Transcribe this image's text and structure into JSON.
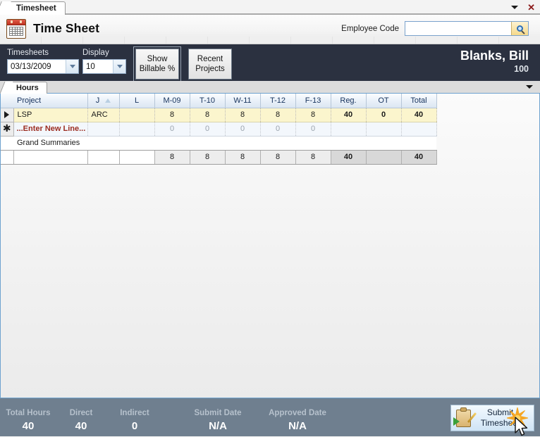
{
  "window": {
    "tab_label": "Timesheet",
    "minimize_icon": "chevron-down-icon",
    "close_icon": "close-icon",
    "close_label": "✕"
  },
  "header": {
    "app_icon": "calendar-icon",
    "title": "Time Sheet",
    "employee_code_label": "Employee Code",
    "employee_code_value": "",
    "employee_code_placeholder": "",
    "search_icon": "magnifier-search-icon"
  },
  "toolbar": {
    "timesheets_label": "Timesheets",
    "timesheets_value": "03/13/2009",
    "display_label": "Display",
    "display_value": "10",
    "show_billable_label_line1": "Show",
    "show_billable_label_line2": "Billable %",
    "recent_projects_label_line1": "Recent",
    "recent_projects_label_line2": "Projects",
    "employee_name": "Blanks, Bill",
    "employee_number": "100"
  },
  "tabstrip": {
    "active_tab": "Hours",
    "overflow_icon": "chevron-down-icon"
  },
  "grid": {
    "columns": [
      {
        "key": "sel",
        "label": ""
      },
      {
        "key": "proj",
        "label": "Project"
      },
      {
        "key": "j",
        "label": "J",
        "sorted": "asc"
      },
      {
        "key": "l",
        "label": "L"
      },
      {
        "key": "m09",
        "label": "M-09"
      },
      {
        "key": "t10",
        "label": "T-10"
      },
      {
        "key": "w11",
        "label": "W-11"
      },
      {
        "key": "t12",
        "label": "T-12"
      },
      {
        "key": "f13",
        "label": "F-13"
      },
      {
        "key": "reg",
        "label": "Reg."
      },
      {
        "key": "ot",
        "label": "OT"
      },
      {
        "key": "tot",
        "label": "Total"
      }
    ],
    "rows": [
      {
        "marker": "row-selected-arrow",
        "project": "LSP",
        "j": "ARC",
        "l": "",
        "m09": "8",
        "t10": "8",
        "w11": "8",
        "t12": "8",
        "f13": "8",
        "reg": "40",
        "ot": "0",
        "tot": "40"
      }
    ],
    "new_row": {
      "marker": "new-row-asterisk",
      "marker_glyph": "✱",
      "project": "...Enter New Line...",
      "j": "",
      "l": "",
      "m09": "0",
      "t10": "0",
      "w11": "0",
      "t12": "0",
      "f13": "0",
      "reg": "",
      "ot": "",
      "tot": ""
    },
    "grand_summaries_label": "Grand Summaries",
    "totals_row": {
      "proj": "",
      "j": "",
      "l": "",
      "m09": "8",
      "t10": "8",
      "w11": "8",
      "t12": "8",
      "f13": "8",
      "reg": "40",
      "ot": "",
      "tot": "40"
    }
  },
  "footer": {
    "stats": [
      {
        "label": "Total Hours",
        "value": "40"
      },
      {
        "label": "Direct",
        "value": "40"
      },
      {
        "label": "Indirect",
        "value": "0"
      },
      {
        "label": "Submit Date",
        "value": "N/A"
      },
      {
        "label": "Approved Date",
        "value": "N/A"
      }
    ],
    "submit_button": {
      "line1": "Submit",
      "line2": "Timesheet",
      "icon": "clipboard-submit-icon"
    }
  },
  "colors": {
    "dark_bar": "#2b3140",
    "footer_bar": "#6f7f8f",
    "selected_row": "#fbf5cd",
    "header_blue": "#dbe6f2",
    "accent_border": "#6ea2cf",
    "new_line_text": "#9b2c20"
  }
}
